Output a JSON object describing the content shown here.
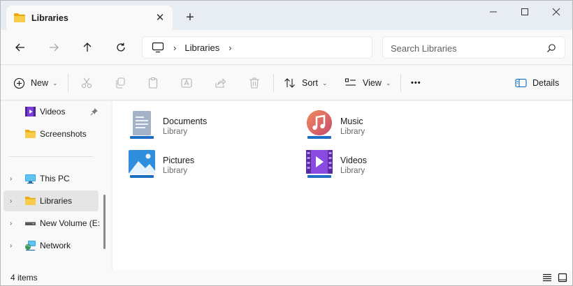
{
  "tab": {
    "title": "Libraries",
    "close_glyph": "✕"
  },
  "new_tab_glyph": "+",
  "window_controls": {
    "minimize": "—",
    "maximize": "▢",
    "close": "✕"
  },
  "nav": {
    "back_glyph": "←",
    "forward_glyph": "→",
    "up_glyph": "↑",
    "refresh_glyph": "⟳"
  },
  "address": {
    "sep1": "›",
    "crumb": "Libraries",
    "sep2": "›"
  },
  "search": {
    "placeholder": "Search Libraries"
  },
  "toolbar": {
    "new_label": "New",
    "sort_label": "Sort",
    "view_label": "View",
    "more_glyph": "•••",
    "details_label": "Details",
    "dropdown_glyph": "⌄"
  },
  "sidebar": {
    "chevron_glyph": "›",
    "items": [
      {
        "label": "Videos",
        "icon": "videos-icon"
      },
      {
        "label": "Screenshots",
        "icon": "folder-icon"
      },
      {
        "label": "This PC",
        "icon": "computer-icon"
      },
      {
        "label": "Libraries",
        "icon": "library-folder-icon"
      },
      {
        "label": "New Volume (E:",
        "icon": "drive-icon"
      },
      {
        "label": "Network",
        "icon": "network-icon"
      }
    ]
  },
  "libraries": [
    {
      "name": "Documents",
      "type": "Library",
      "icon": "documents-library-icon"
    },
    {
      "name": "Music",
      "type": "Library",
      "icon": "music-library-icon"
    },
    {
      "name": "Pictures",
      "type": "Library",
      "icon": "pictures-library-icon"
    },
    {
      "name": "Videos",
      "type": "Library",
      "icon": "videos-library-icon"
    }
  ],
  "status": {
    "count": "4 items"
  },
  "colors": {
    "accent": "#0067c0",
    "folder_yellow": "#f5c542",
    "selected_bg": "#e5e5e5",
    "titlebar_bg": "#e8edf3"
  }
}
